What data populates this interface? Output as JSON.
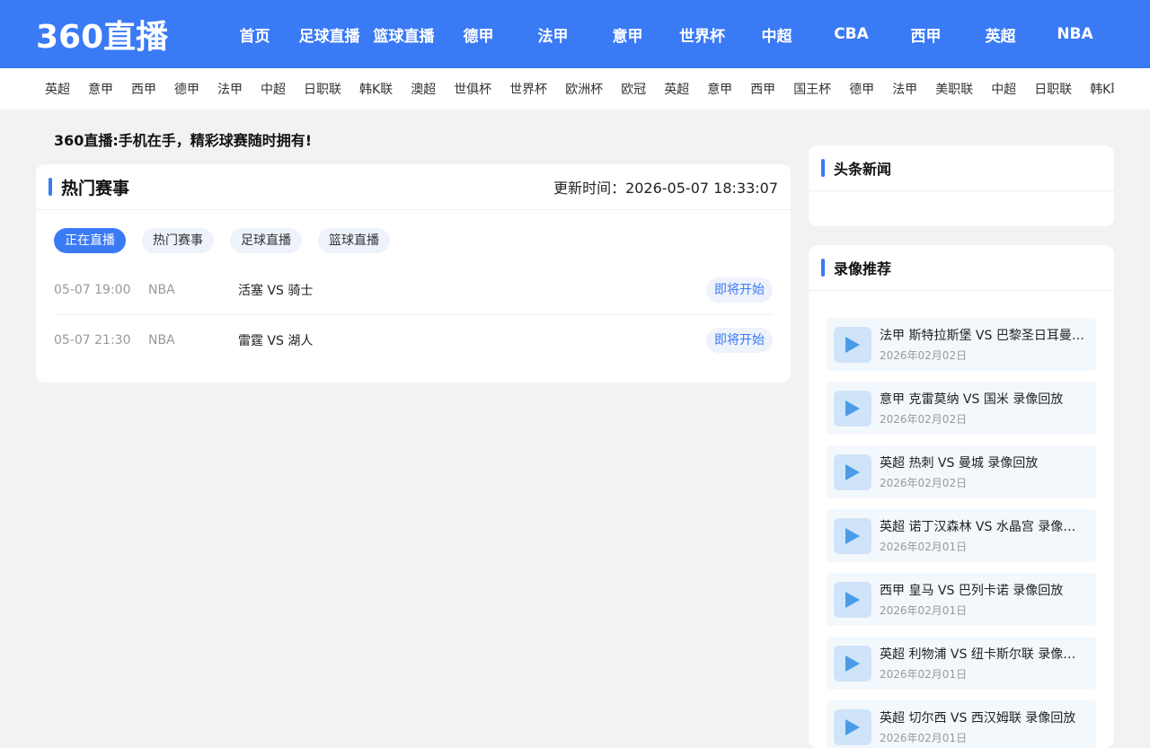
{
  "header": {
    "logo": "360直播",
    "nav": [
      "首页",
      "足球直播",
      "篮球直播",
      "德甲",
      "法甲",
      "意甲",
      "世界杯",
      "中超",
      "CBA",
      "西甲",
      "英超",
      "NBA"
    ]
  },
  "subnav": [
    "英超",
    "意甲",
    "西甲",
    "德甲",
    "法甲",
    "中超",
    "日职联",
    "韩K联",
    "澳超",
    "世俱杯",
    "世界杯",
    "欧洲杯",
    "欧冠",
    "英超",
    "意甲",
    "西甲",
    "国王杯",
    "德甲",
    "法甲",
    "美职联",
    "中超",
    "日职联",
    "韩K联"
  ],
  "slogan": "360直播:手机在手，精彩球赛随时拥有!",
  "hot": {
    "title": "热门赛事",
    "update_label": "更新时间：2026-05-07 18:33:07",
    "tabs": [
      "正在直播",
      "热门赛事",
      "足球直播",
      "篮球直播"
    ],
    "matches": [
      {
        "time": "05-07 19:00",
        "league": "NBA",
        "teams": "活塞 VS 骑士",
        "status": "即将开始"
      },
      {
        "time": "05-07 21:30",
        "league": "NBA",
        "teams": "雷霆 VS 湖人",
        "status": "即将开始"
      }
    ]
  },
  "news": {
    "title": "头条新闻"
  },
  "recordings": {
    "title": "录像推荐",
    "items": [
      {
        "title": "法甲 斯特拉斯堡 VS 巴黎圣日耳曼 录像回放",
        "date": "2026年02月02日"
      },
      {
        "title": "意甲 克雷莫纳 VS 国米 录像回放",
        "date": "2026年02月02日"
      },
      {
        "title": "英超 热刺 VS 曼城 录像回放",
        "date": "2026年02月02日"
      },
      {
        "title": "英超 诺丁汉森林 VS 水晶宫 录像回放",
        "date": "2026年02月01日"
      },
      {
        "title": "西甲 皇马 VS 巴列卡诺 录像回放",
        "date": "2026年02月01日"
      },
      {
        "title": "英超 利物浦 VS 纽卡斯尔联 录像回放",
        "date": "2026年02月01日"
      },
      {
        "title": "英超 切尔西 VS 西汉姆联 录像回放",
        "date": "2026年02月01日"
      }
    ]
  },
  "colors": {
    "accent": "#3a7af5",
    "background": "#f2f2f2",
    "play_icon": "#4a9be8"
  },
  "icons": {
    "play": "play-icon",
    "title_marker": "title-bar"
  }
}
